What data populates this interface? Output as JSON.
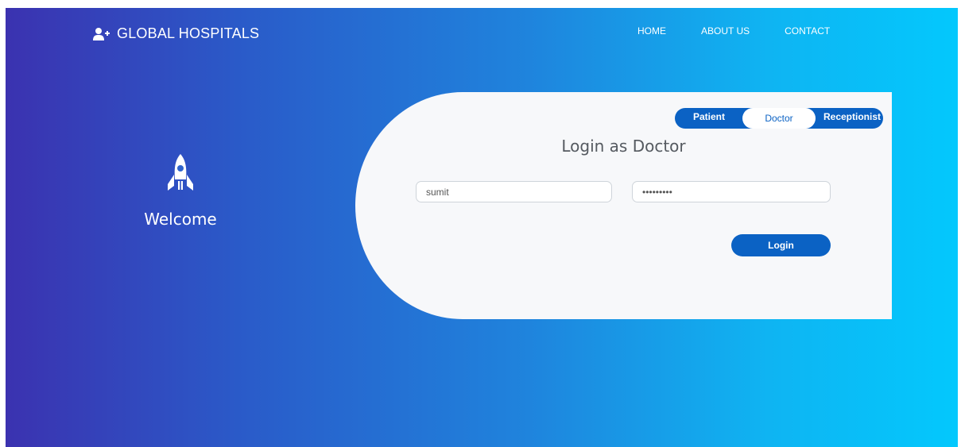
{
  "navbar": {
    "brand_icon": "user-plus-icon",
    "brand": "GLOBAL HOSPITALS",
    "links": [
      "HOME",
      "ABOUT US",
      "CONTACT"
    ]
  },
  "welcome": {
    "icon": "rocket-icon",
    "text": "Welcome"
  },
  "login": {
    "tabs": {
      "patient": "Patient",
      "doctor": "Doctor",
      "receptionist": "Receptionist",
      "active": "Doctor"
    },
    "title": "Login as Doctor",
    "username_value": "sumit",
    "password_value": "sumit1234",
    "button": "Login"
  },
  "colors": {
    "gradient_start": "#3b32b0",
    "gradient_end": "#03c8fd",
    "primary": "#0b62c4",
    "card_bg": "#f7f8fa"
  }
}
